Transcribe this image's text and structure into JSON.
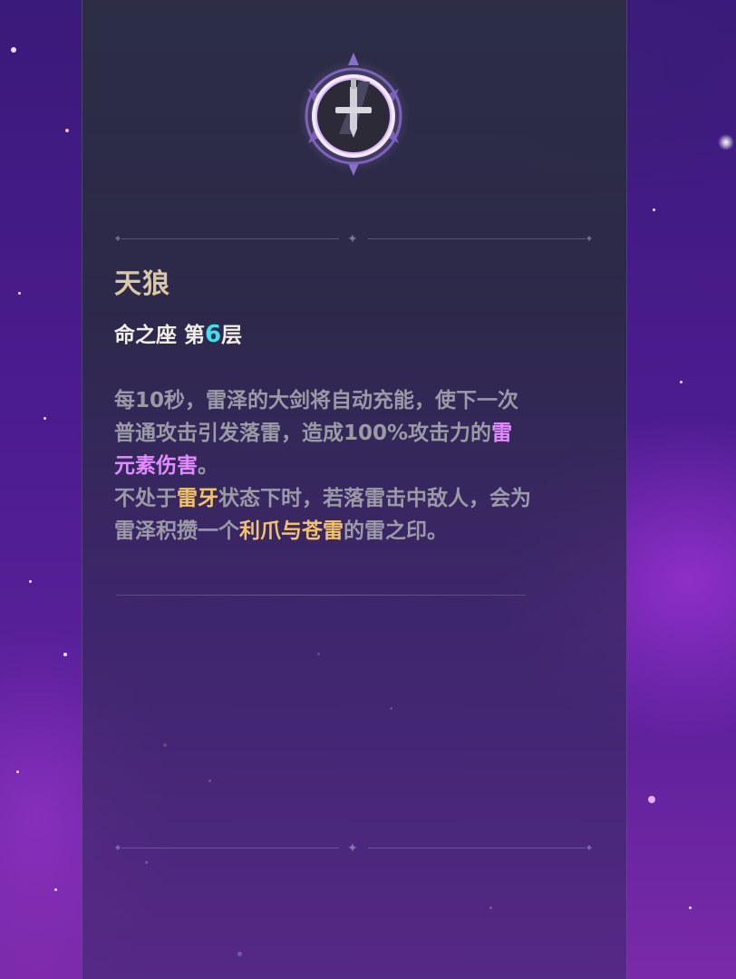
{
  "constellation": {
    "name": "天狼",
    "level_prefix": "命之座 第",
    "level_number": "6",
    "level_suffix": "层",
    "icon": "sword-lightning-icon"
  },
  "description": {
    "p1": "每10秒，雷泽的大剑将自动充能，使下一次普通攻击引发落雷，造成100%攻击力的",
    "p1_highlight": "雷元素伤害",
    "p1_end": "。",
    "p2_start": "不处于",
    "p2_highlight1": "雷牙",
    "p2_mid": "状态下时，若落雷击中敌人，会为雷泽积攒一个",
    "p2_highlight2": "利爪与苍雷",
    "p2_end": "的雷之印。"
  },
  "colors": {
    "title": "#d9c9a2",
    "level_number": "#3ee0ea",
    "electro_highlight": "#e48bff",
    "gold_highlight": "#f3c465",
    "body_text": "#9c9aa6"
  }
}
